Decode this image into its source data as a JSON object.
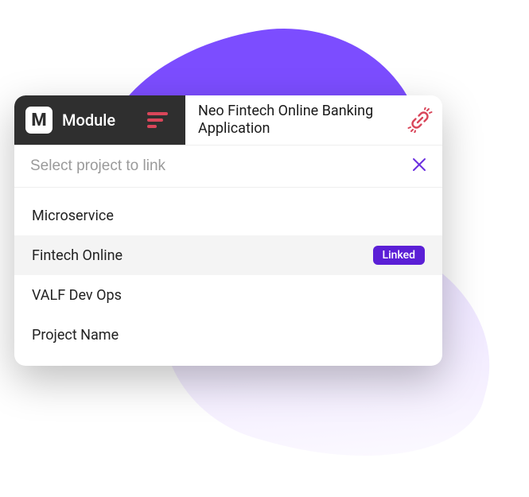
{
  "header": {
    "logo_letter": "M",
    "module_label": "Module",
    "project_title": "Neo Fintech Online Banking Application"
  },
  "search": {
    "placeholder": "Select project to link"
  },
  "badge_label": "Linked",
  "items": [
    {
      "label": "Microservice",
      "linked": false,
      "selected": false
    },
    {
      "label": "Fintech Online",
      "linked": true,
      "selected": true
    },
    {
      "label": "VALF Dev Ops",
      "linked": false,
      "selected": false
    },
    {
      "label": "Project Name",
      "linked": false,
      "selected": false
    }
  ]
}
